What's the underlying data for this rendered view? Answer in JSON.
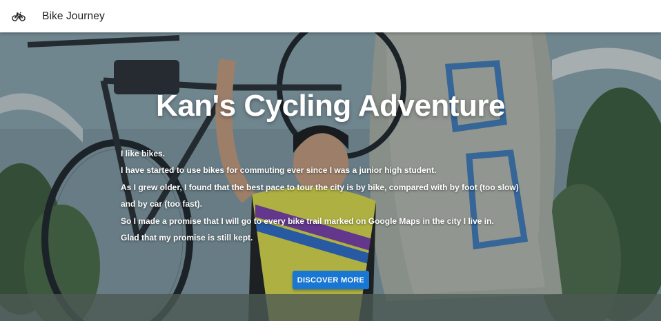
{
  "appbar": {
    "title": "Bike Journey",
    "icon": "bicycle-icon"
  },
  "hero": {
    "title": "Kan's Cycling Adventure",
    "paragraphs": [
      "I like bikes.",
      "I have started to use bikes for commuting ever since I was a junior high student.",
      "As I grew older, I found that the best pace to tour the city is by bike, compared with by foot (too slow) and by car (too fast).",
      "So I made a promise that I will go to every bike trail marked on Google Maps in the city I live in.",
      "Glad that my promise is still kept."
    ],
    "cta_label": "DISCOVER MORE"
  },
  "colors": {
    "primary": "#1976d2",
    "appbar_bg": "#ffffff",
    "hero_text": "#ffffff"
  }
}
